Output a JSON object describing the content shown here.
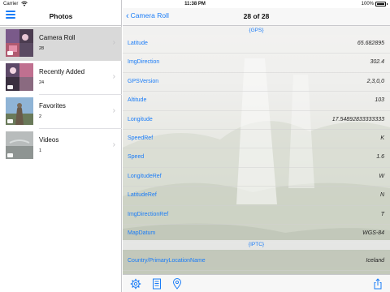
{
  "status": {
    "carrier": "Carrier",
    "time": "11:38 PM",
    "battery": "100%"
  },
  "sidebar": {
    "title": "Photos",
    "albums": [
      {
        "name": "Camera Roll",
        "count": "28"
      },
      {
        "name": "Recently Added",
        "count": "24"
      },
      {
        "name": "Favorites",
        "count": "2"
      },
      {
        "name": "Videos",
        "count": "1"
      }
    ]
  },
  "detail": {
    "back_label": "Camera Roll",
    "title": "28 of 28",
    "gps_header": "{GPS}",
    "gps_rows": [
      {
        "key": "Latitude",
        "value": "65.682895"
      },
      {
        "key": "ImgDirection",
        "value": "302.4"
      },
      {
        "key": "GPSVersion",
        "value": "2,3,0,0"
      },
      {
        "key": "Altitude",
        "value": "103"
      },
      {
        "key": "Longitude",
        "value": "17.54892833333333"
      },
      {
        "key": "SpeedRef",
        "value": "K"
      },
      {
        "key": "Speed",
        "value": "1.6"
      },
      {
        "key": "LongitudeRef",
        "value": "W"
      },
      {
        "key": "LatitudeRef",
        "value": "N"
      },
      {
        "key": "ImgDirectionRef",
        "value": "T"
      },
      {
        "key": "MapDatum",
        "value": "WGS-84"
      }
    ],
    "iptc_header": "{IPTC}",
    "iptc_rows": [
      {
        "key": "Country/PrimaryLocationName",
        "value": "Iceland"
      }
    ]
  },
  "toolbar": {
    "icons": [
      "gear-icon",
      "document-icon",
      "location-pin-icon",
      "share-icon"
    ]
  },
  "colors": {
    "accent": "#1a7cf7",
    "selected_row": "#d9d9d9"
  }
}
